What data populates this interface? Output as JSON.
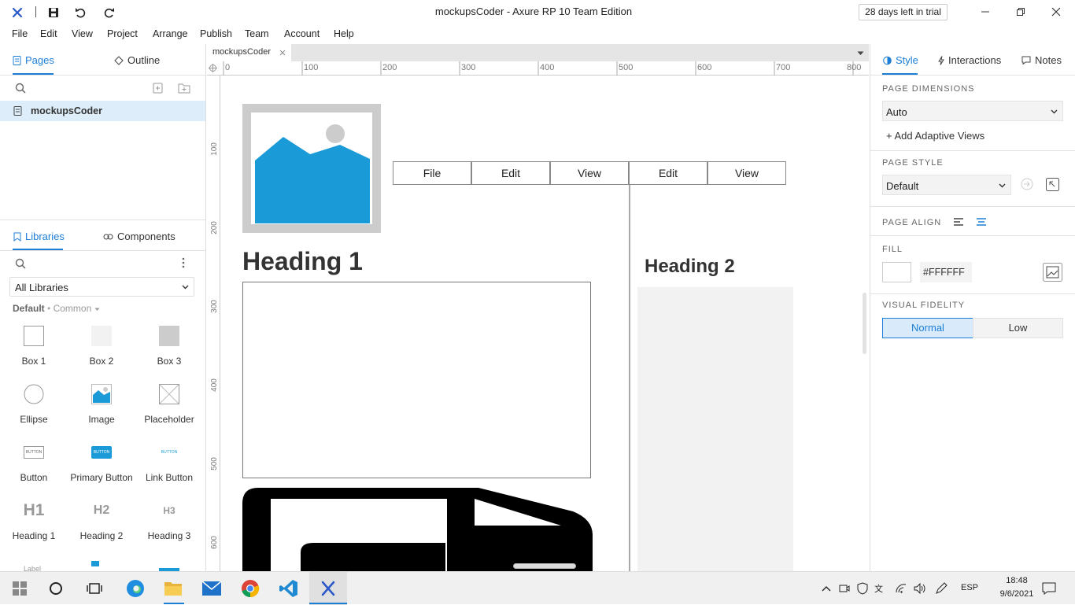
{
  "window": {
    "title": "mockupsCoder - Axure RP 10 Team Edition",
    "trial": "28 days left in trial"
  },
  "menu": [
    "File",
    "Edit",
    "View",
    "Project",
    "Arrange",
    "Publish",
    "Team",
    "Account",
    "Help"
  ],
  "left_panel": {
    "tabs": {
      "pages": "Pages",
      "outline": "Outline"
    },
    "pages": [
      {
        "label": "mockupsCoder"
      }
    ],
    "lib_tabs": {
      "libraries": "Libraries",
      "components": "Components"
    },
    "library_select": "All Libraries",
    "library_crumb": {
      "default": "Default",
      "sep": "•",
      "common": "Common"
    },
    "items": [
      {
        "label": "Box 1"
      },
      {
        "label": "Box 2"
      },
      {
        "label": "Box 3"
      },
      {
        "label": "Ellipse"
      },
      {
        "label": "Image"
      },
      {
        "label": "Placeholder"
      },
      {
        "label": "Button"
      },
      {
        "label": "Primary Button"
      },
      {
        "label": "Link Button"
      },
      {
        "label": "Heading 1"
      },
      {
        "label": "Heading 2"
      },
      {
        "label": "Heading 3"
      }
    ],
    "item_thumbs": {
      "button": "BUTTON",
      "h1": "H1",
      "h2": "H2",
      "h3": "H3",
      "label": "Label"
    }
  },
  "document_tab": "mockupsCoder",
  "rulers": {
    "top": [
      "0",
      "100",
      "200",
      "300",
      "400",
      "500",
      "600",
      "700",
      "800"
    ],
    "left": [
      "100",
      "200",
      "300",
      "400",
      "500",
      "600"
    ]
  },
  "canvas": {
    "nav": [
      "File",
      "Edit",
      "View",
      "Edit",
      "View"
    ],
    "heading1": "Heading 1",
    "heading2": "Heading 2"
  },
  "right_panel": {
    "tabs": {
      "style": "Style",
      "interactions": "Interactions",
      "notes": "Notes"
    },
    "page_dimensions_label": "PAGE DIMENSIONS",
    "page_dimensions_value": "Auto",
    "add_adaptive": "+ Add Adaptive Views",
    "page_style_label": "PAGE STYLE",
    "page_style_value": "Default",
    "page_align_label": "PAGE ALIGN",
    "fill_label": "FILL",
    "fill_value": "#FFFFFF",
    "visual_fidelity_label": "VISUAL FIDELITY",
    "fidelity_normal": "Normal",
    "fidelity_low": "Low"
  },
  "taskbar": {
    "language": "ESP",
    "time": "18:48",
    "date": "9/6/2021"
  },
  "colors": {
    "accent": "#1c7ed6",
    "image_blue": "#1a9ad6"
  }
}
